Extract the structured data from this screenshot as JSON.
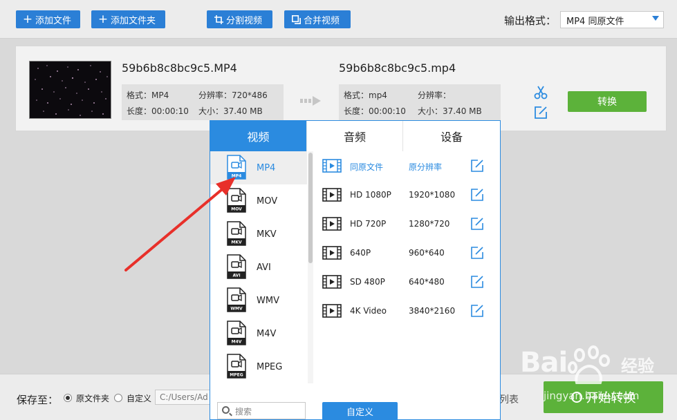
{
  "toolbar": {
    "add_file": "添加文件",
    "add_folder": "添加文件夹",
    "split_video": "分割视频",
    "merge_video": "合并视频",
    "output_format_label": "输出格式：",
    "output_format_value": "MP4  同原文件"
  },
  "file": {
    "source_name": "59b6b8c8bc9c5.MP4",
    "target_name": "59b6b8c8bc9c5.mp4",
    "source": {
      "format": "格式：MP4",
      "resolution": "分辨率：720*486",
      "duration": "长度：00:00:10",
      "size": "大小：37.40 MB"
    },
    "target": {
      "format": "格式：mp4",
      "resolution": "分辨率：",
      "duration": "长度：00:00:10",
      "size": "大小：37.40 MB"
    },
    "convert_label": "转换"
  },
  "panel": {
    "tabs": [
      "视频",
      "音频",
      "设备"
    ],
    "formats": [
      "MP4",
      "MOV",
      "MKV",
      "AVI",
      "WMV",
      "M4V",
      "MPEG"
    ],
    "selected_format": "MP4",
    "presets": [
      {
        "name": "同原文件",
        "resolution": "原分辨率"
      },
      {
        "name": "HD 1080P",
        "resolution": "1920*1080"
      },
      {
        "name": "HD 720P",
        "resolution": "1280*720"
      },
      {
        "name": "640P",
        "resolution": "960*640"
      },
      {
        "name": "SD 480P",
        "resolution": "640*480"
      },
      {
        "name": "4K Video",
        "resolution": "3840*2160"
      }
    ],
    "search_placeholder": "搜索",
    "custom_label": "自定义"
  },
  "bottom": {
    "save_to_label": "保存至：",
    "option_original": "原文件夹",
    "option_custom": "自定义",
    "path_value": "C:/Users/Ad",
    "list_text": "列表",
    "start_label": "开始转换"
  },
  "watermark": {
    "brand": "Bai",
    "jingyan": "经验",
    "url": "jingyan.baidu.com"
  },
  "colors": {
    "accent": "#2b8be0",
    "toolbar_button": "#2b7fd6",
    "success": "#5cb23a",
    "arrow": "#e8302a"
  }
}
